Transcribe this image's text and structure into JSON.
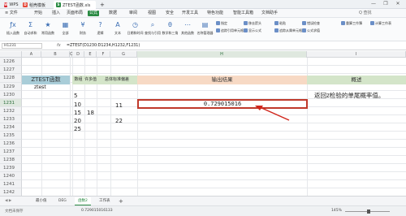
{
  "titlebar": {
    "tabs": [
      {
        "label": "WPS",
        "icon": "wps-home-icon",
        "color": "#d9282f"
      },
      {
        "label": "稻壳模板",
        "icon": "docer-icon",
        "color": "#e64a3b"
      },
      {
        "label": "ZTEST函数.xls",
        "icon": "spreadsheet-icon",
        "color": "#2a8a43"
      }
    ],
    "new_tab": "+",
    "window_buttons": [
      "—",
      "❐",
      "✕"
    ]
  },
  "menubar": {
    "file_menu": "≡ 文件",
    "items": [
      "开始",
      "插入",
      "页面布局",
      "公式",
      "数据",
      "审阅",
      "视图",
      "安全",
      "开发工具",
      "特色功能",
      "智能工具箱",
      "文档助手"
    ],
    "active": "公式",
    "search": "Q 查找",
    "accent": "#2a8a43"
  },
  "ribbon": {
    "buttons": [
      {
        "label": "插入函数",
        "icon": "ƒx"
      },
      {
        "label": "自动求和",
        "icon": "Σ"
      },
      {
        "label": "常用函数",
        "icon": "★"
      },
      {
        "label": "全部",
        "icon": "▦"
      },
      {
        "label": "财务",
        "icon": "¥"
      },
      {
        "label": "逻辑",
        "icon": "?"
      },
      {
        "label": "文本",
        "icon": "A"
      },
      {
        "label": "日期和时间",
        "icon": "◷"
      },
      {
        "label": "查找与引用",
        "icon": "⌕"
      },
      {
        "label": "数学和三角",
        "icon": "θ"
      },
      {
        "label": "其他函数",
        "icon": "⋯"
      },
      {
        "label": "名称管理器",
        "icon": "▤"
      }
    ],
    "small": [
      "指定",
      "追踪引用单元格",
      "移去箭头",
      "显示公式",
      "粘贴",
      "追踪从属单元格",
      "错误检查",
      "公式求值",
      "重算工作簿",
      "计算工作表"
    ]
  },
  "formula_bar": {
    "cell_ref": "H1231",
    "fx": "fx",
    "formula": "=ZTEST(D1230:D1234,H1232,F1231)"
  },
  "columns": [
    "A",
    "B",
    "C",
    "D",
    "E",
    "F",
    "G",
    "H",
    "I"
  ],
  "rows": [
    "1226",
    "1227",
    "1228",
    "1229",
    "1230",
    "1231",
    "1232",
    "1233",
    "1234",
    "1235",
    "1236",
    "1237",
    "1238",
    "1239",
    "1240",
    "1241",
    "1242"
  ],
  "sheet": {
    "title_cell": "ZTEST函数",
    "fn_name": "ztest",
    "headers": {
      "d": "数组",
      "e": "许多值",
      "f": "总体标准偏差",
      "h": "输出结果",
      "i": "概述"
    },
    "d_values": [
      "5",
      "10",
      "15",
      "20",
      "25"
    ],
    "e_value": "18",
    "f_values": [
      "11",
      "22"
    ],
    "result": "0.729015016",
    "description": "返回z检验的单尾概率值。"
  },
  "sheet_tabs": [
    "最小值",
    "DEG",
    "函数2",
    "工作表"
  ],
  "active_sheet": "函数2",
  "status": {
    "left": "文档未保存",
    "value": "0.729015016133",
    "zoom": "145%"
  }
}
